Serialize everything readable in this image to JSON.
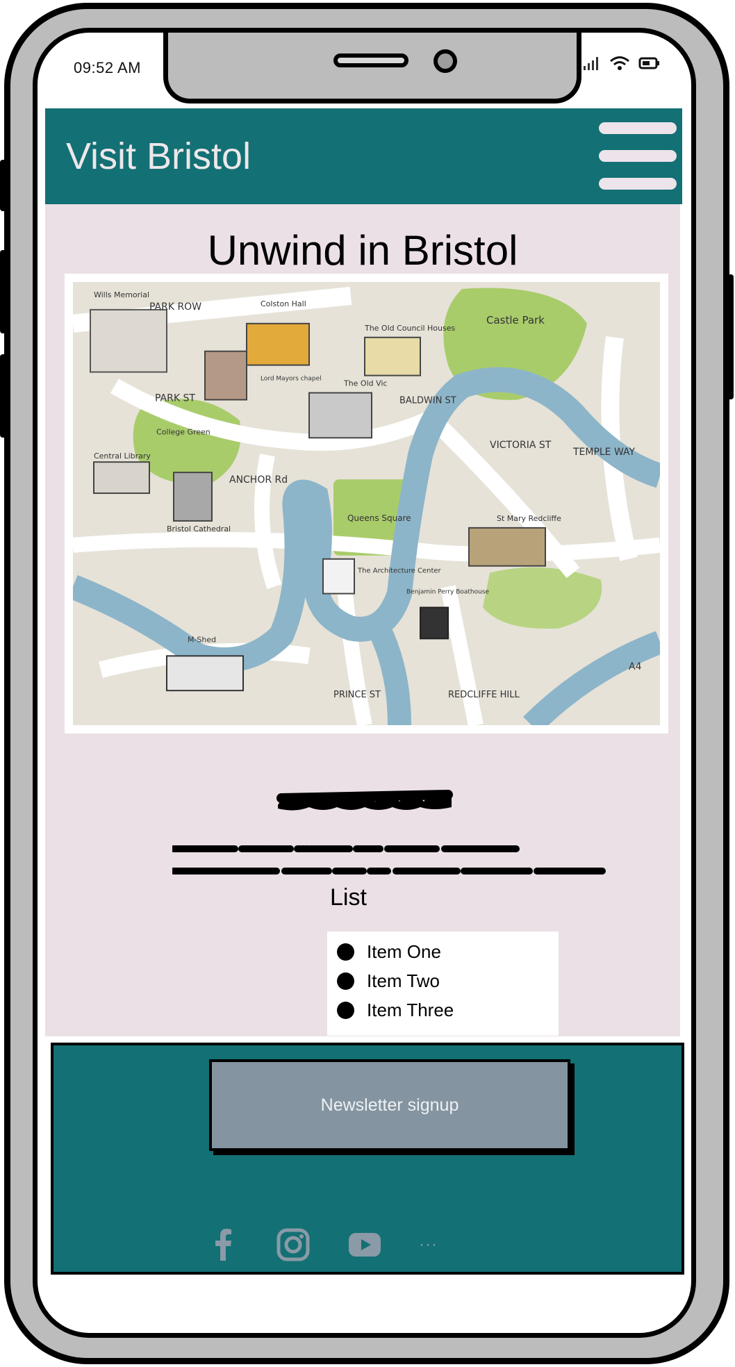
{
  "status_bar": {
    "time": "09:52 AM"
  },
  "header": {
    "brand": "Visit Bristol",
    "menu_icon": "hamburger-menu-icon"
  },
  "main": {
    "title": "Unwind in Bristol",
    "map": {
      "labels": {
        "wills_memorial": "Wills Memorial",
        "park_row": "PARK ROW",
        "colston_hall": "Colston Hall",
        "old_council": "The Old Council Houses",
        "castle_park": "Castle Park",
        "lord_mayors": "Lord Mayors chapel",
        "park_st": "PARK ST",
        "old_vic": "The Old Vic",
        "baldwin_st": "BALDWIN ST",
        "college_green": "College Green",
        "central_library": "Central Library",
        "anchor_rd": "ANCHOR Rd",
        "queens_square": "Queens Square",
        "victoria_st": "VICTORIA ST",
        "temple_way": "TEMPLE WAY",
        "st_mary": "St Mary Redcliffe",
        "bristol_cathedral": "Bristol Cathedral",
        "architecture_center": "The Architecture Center",
        "benjamin_perry": "Benjamin Perry Boathouse",
        "m_shed": "M-Shed",
        "prince_st": "PRINCE ST",
        "redcliffe_hill": "REDCLIFFE HILL",
        "a4": "A4"
      }
    },
    "list": {
      "heading": "List",
      "items": [
        "Item One",
        "Item Two",
        "Item Three"
      ]
    }
  },
  "footer": {
    "newsletter_label": "Newsletter signup",
    "social_icons": [
      "facebook-icon",
      "instagram-icon",
      "youtube-icon"
    ],
    "more_label": "···"
  },
  "colors": {
    "header_bg": "#137074",
    "content_bg": "#ebe0e6",
    "button_bg": "#8494a0",
    "phone_frame": "#bcbcbc"
  }
}
